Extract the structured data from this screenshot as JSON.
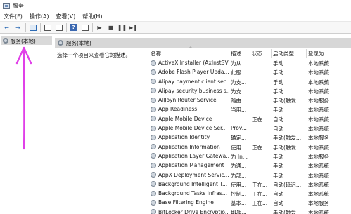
{
  "window": {
    "title": "服务"
  },
  "menu": [
    "文件(F)",
    "操作(A)",
    "查看(V)",
    "帮助(H)"
  ],
  "toolbar": {
    "back_glyph": "←",
    "forward_glyph": "→",
    "help_glyph": "?",
    "play_glyph": "▶",
    "stop_glyph": "■",
    "pause_glyph": "❚❚",
    "restart_glyph": "▶❚"
  },
  "tree": {
    "root_label": "服务(本地)"
  },
  "panel": {
    "title": "服务(本地)",
    "description_prompt": "选择一个项目来查看它的描述。"
  },
  "table": {
    "columns": {
      "name": "名称",
      "desc": "描述",
      "status": "状态",
      "startup": "启动类型",
      "logon": "登录为"
    },
    "rows": [
      {
        "name": "ActiveX Installer (AxInstSV)",
        "desc": "为从 ...",
        "status": "",
        "startup": "手动",
        "logon": "本地系统"
      },
      {
        "name": "Adobe Flash Player Upda...",
        "desc": "此服...",
        "status": "",
        "startup": "手动",
        "logon": "本地系统"
      },
      {
        "name": "Alipay payment client sec...",
        "desc": "为支...",
        "status": "",
        "startup": "手动",
        "logon": "本地系统"
      },
      {
        "name": "Alipay security business s...",
        "desc": "为支...",
        "status": "",
        "startup": "手动",
        "logon": "本地系统"
      },
      {
        "name": "AllJoyn Router Service",
        "desc": "路由...",
        "status": "",
        "startup": "手动(触发...",
        "logon": "本地服务"
      },
      {
        "name": "App Readiness",
        "desc": "当用...",
        "status": "",
        "startup": "手动",
        "logon": "本地系统"
      },
      {
        "name": "Apple Mobile Device",
        "desc": "",
        "status": "正在...",
        "startup": "自动",
        "logon": "本地系统"
      },
      {
        "name": "Apple Mobile Device Ser...",
        "desc": "Prov...",
        "status": "",
        "startup": "自动",
        "logon": "本地系统"
      },
      {
        "name": "Application Identity",
        "desc": "确定...",
        "status": "",
        "startup": "手动(触发...",
        "logon": "本地服务"
      },
      {
        "name": "Application Information",
        "desc": "使用...",
        "status": "正在...",
        "startup": "手动(触发...",
        "logon": "本地系统"
      },
      {
        "name": "Application Layer Gatewa...",
        "desc": "为 In...",
        "status": "",
        "startup": "手动",
        "logon": "本地服务"
      },
      {
        "name": "Application Management",
        "desc": "为通...",
        "status": "",
        "startup": "手动",
        "logon": "本地系统"
      },
      {
        "name": "AppX Deployment Servic...",
        "desc": "为部...",
        "status": "",
        "startup": "手动",
        "logon": "本地系统"
      },
      {
        "name": "Background Intelligent T...",
        "desc": "使用...",
        "status": "正在...",
        "startup": "自动(延迟...",
        "logon": "本地系统"
      },
      {
        "name": "Background Tasks Infras...",
        "desc": "控制...",
        "status": "正在...",
        "startup": "自动",
        "logon": "本地系统"
      },
      {
        "name": "Base Filtering Engine",
        "desc": "基本...",
        "status": "正在...",
        "startup": "自动",
        "logon": "本地服务"
      },
      {
        "name": "BitLocker Drive Encryptio...",
        "desc": "BDE...",
        "status": "",
        "startup": "手动(触发...",
        "logon": "本地系统"
      }
    ]
  },
  "colors": {
    "annotation_arrow": "#e040e8",
    "header_bg": "#d7d7d7"
  }
}
